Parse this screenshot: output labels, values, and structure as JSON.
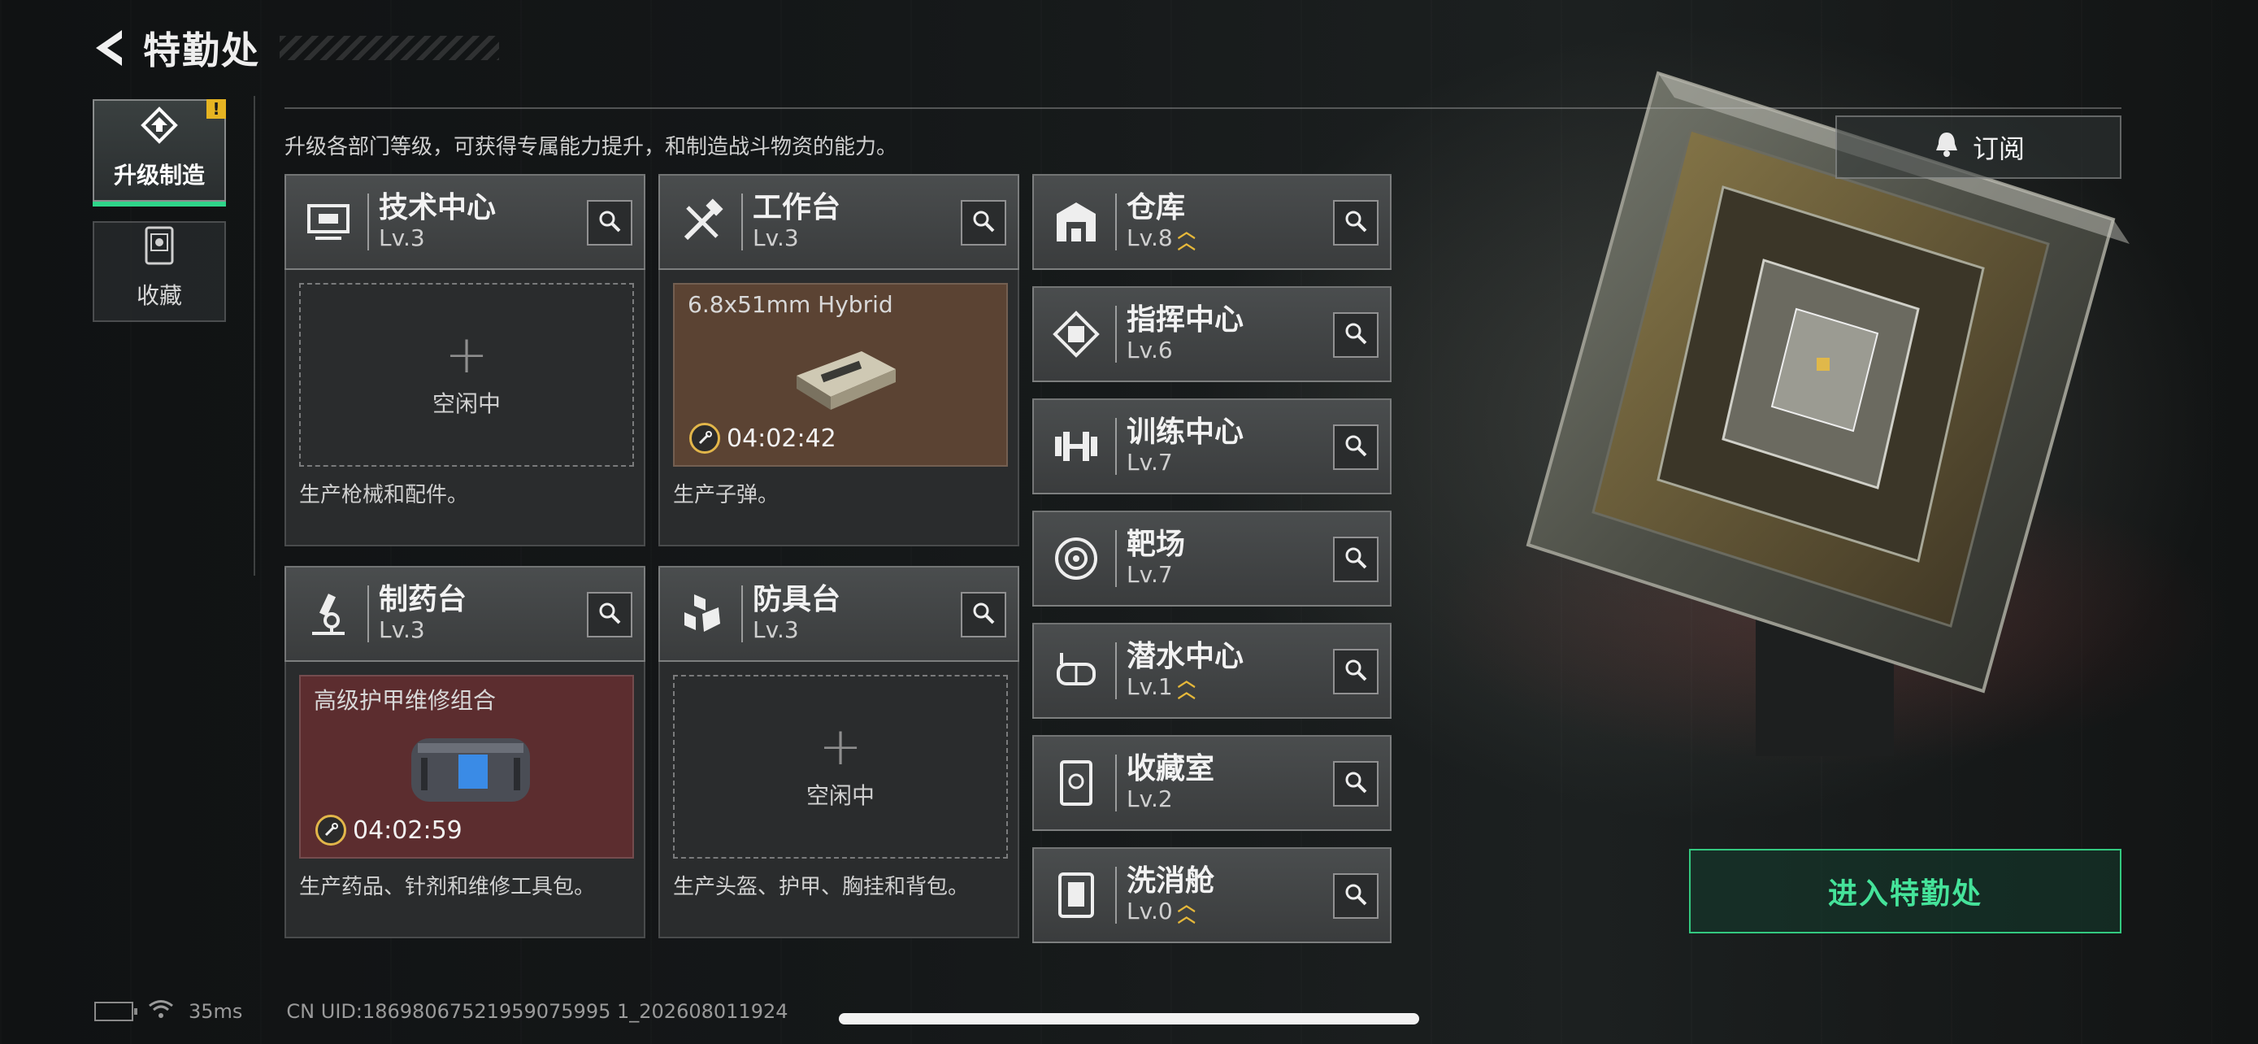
{
  "header": {
    "title": "特勤处"
  },
  "sidebar": {
    "tabs": [
      {
        "label": "升级制造",
        "active": true,
        "badge": "!"
      },
      {
        "label": "收藏",
        "active": false
      }
    ]
  },
  "description": "升级各部门等级，可获得专属能力提升，和制造战斗物资的能力。",
  "subscribe": {
    "label": "订阅"
  },
  "facilities": [
    {
      "name": "技术中心",
      "level": "Lv.3",
      "slot": {
        "state": "idle",
        "plus": "+",
        "text": "空闲中"
      },
      "desc": "生产枪械和配件。"
    },
    {
      "name": "工作台",
      "level": "Lv.3",
      "slot": {
        "state": "producing",
        "item": "6.8x51mm Hybrid",
        "timer": "04:02:42"
      },
      "desc": "生产子弹。"
    },
    {
      "name": "制药台",
      "level": "Lv.3",
      "slot": {
        "state": "producing",
        "item": "高级护甲维修组合",
        "timer": "04:02:59"
      },
      "desc": "生产药品、针剂和维修工具包。"
    },
    {
      "name": "防具台",
      "level": "Lv.3",
      "slot": {
        "state": "idle",
        "plus": "+",
        "text": "空闲中"
      },
      "desc": "生产头盔、护甲、胸挂和背包。"
    }
  ],
  "departments": [
    {
      "name": "仓库",
      "level": "Lv.8",
      "upgradable": true
    },
    {
      "name": "指挥中心",
      "level": "Lv.6",
      "upgradable": false
    },
    {
      "name": "训练中心",
      "level": "Lv.7",
      "upgradable": false
    },
    {
      "name": "靶场",
      "level": "Lv.7",
      "upgradable": false
    },
    {
      "name": "潜水中心",
      "level": "Lv.1",
      "upgradable": true
    },
    {
      "name": "收藏室",
      "level": "Lv.2",
      "upgradable": false
    },
    {
      "name": "洗消舱",
      "level": "Lv.0",
      "upgradable": true
    }
  ],
  "enter": {
    "label": "进入特勤处"
  },
  "status_bar": {
    "ping": "35ms",
    "uid": "CN UID:18698067521959075995 1_202608011924"
  },
  "colors": {
    "accent_green": "#2fd58a",
    "upgrade_gold": "#e6b83a",
    "warn_yellow": "#e6b422"
  }
}
